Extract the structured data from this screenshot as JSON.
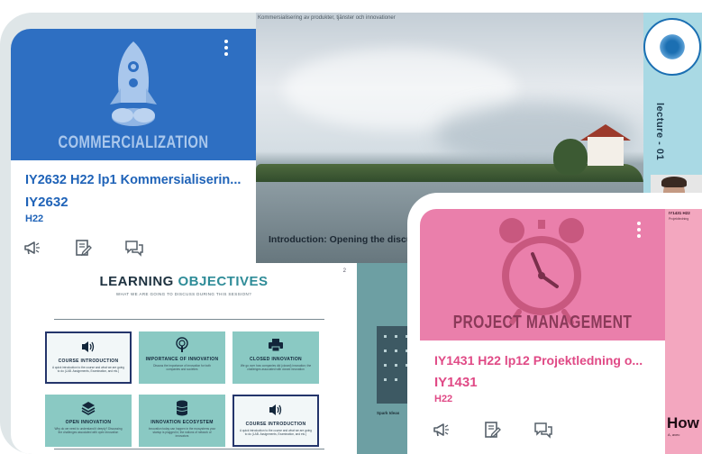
{
  "course_card_1": {
    "banner_title": "COMMERCIALIZATION",
    "title": "IY2632 H22 lp1 Kommersialiserin...",
    "code": "IY2632",
    "term": "H22",
    "banner_color": "#2e6fc2",
    "text_color": "#1f63b8",
    "icons": [
      "megaphone-icon",
      "assignment-icon",
      "discussion-icon"
    ]
  },
  "photo_slide": {
    "caption": "Kommersialisering av produkter, tjänster och innovationer",
    "title": "Introduction: Opening the discu"
  },
  "lecture_strip": {
    "label": "lecture - 01",
    "background": "#a9d9e4"
  },
  "learning_objectives": {
    "title_part1": "LEARNING ",
    "title_part2": "OBJECTIVES",
    "subtitle": "WHAT WE ARE GOING TO DISCUSS DURING THIS SESSION?",
    "slide_number": "2",
    "tiles": [
      {
        "title": "COURSE INTRODUCTION",
        "desc": "A quick introduction to the course and what we are going to do (LAB. Assignments, Examination, and etc.)",
        "icon": "speaker-icon",
        "outlined": true
      },
      {
        "title": "IMPORTANCE OF INNOVATION",
        "desc": "Discuss the importance of innovation for both companies and societies",
        "icon": "podcast-icon",
        "outlined": false
      },
      {
        "title": "CLOSED INNOVATION",
        "desc": "We go over how companies did (closed) innovation; the challenges associated with closed innovation",
        "icon": "printer-icon",
        "outlined": false
      },
      {
        "title": "OPEN INNOVATION",
        "desc": "Why do we need to understand it deeply? Discussing the challenges associated with open innovation",
        "icon": "layers-icon",
        "outlined": false
      },
      {
        "title": "INNOVATION ECOSYSTEM",
        "desc": "Innovation today can happen in the ecosystems your startup is plugged in; the notions of network of innovators",
        "icon": "database-icon",
        "outlined": false
      },
      {
        "title": "COURSE INTRODUCTION",
        "desc": "A quick introduction to the course and what we are going to do (LAB. Assignments, Examination, and etc.)",
        "icon": "speaker-icon",
        "outlined": true
      }
    ]
  },
  "teal_slide": {
    "caption": "Spark Ideas"
  },
  "course_card_2": {
    "banner_title": "PROJECT MANAGEMENT",
    "title": "IY1431 H22 lp12 Projektledning o...",
    "code": "IY1431",
    "term": "H22",
    "banner_color": "#ea7fab",
    "text_color": "#e04a86",
    "icons": [
      "megaphone-icon",
      "assignment-icon",
      "discussion-icon"
    ]
  },
  "pink_peek": {
    "head": "IY1431 H22",
    "sub": "Projektledning",
    "big": "How",
    "small": "A, avec"
  }
}
